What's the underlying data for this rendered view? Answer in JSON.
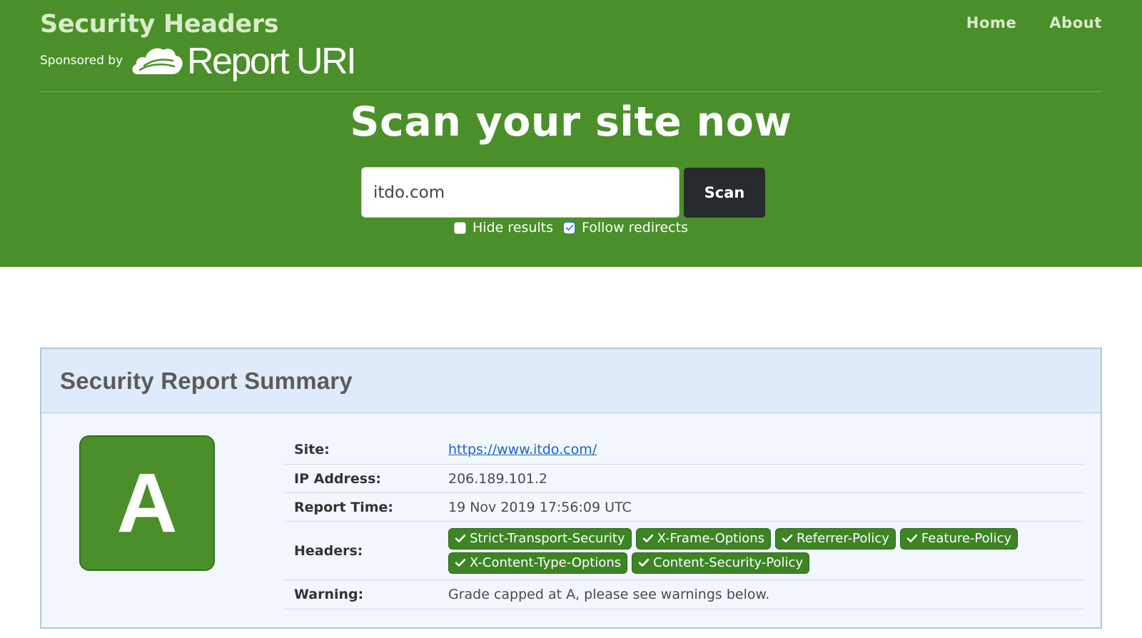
{
  "header": {
    "brand_title": "Security Headers",
    "sponsor_label": "Sponsored by",
    "sponsor_logo_text": "Report URI",
    "nav": [
      {
        "label": "Home"
      },
      {
        "label": "About"
      }
    ],
    "hero_title": "Scan your site now"
  },
  "scan": {
    "input_value": "itdo.com",
    "button_label": "Scan",
    "options": [
      {
        "label": "Hide results",
        "checked": false
      },
      {
        "label": "Follow redirects",
        "checked": true
      }
    ]
  },
  "report": {
    "title": "Security Report Summary",
    "grade": "A",
    "rows": {
      "site": {
        "label": "Site:",
        "value": "https://www.itdo.com/"
      },
      "ip": {
        "label": "IP Address:",
        "value": "206.189.101.2"
      },
      "time": {
        "label": "Report Time:",
        "value": "19 Nov 2019 17:56:09 UTC"
      },
      "headers": {
        "label": "Headers:"
      },
      "warning": {
        "label": "Warning:",
        "value": "Grade capped at A, please see warnings below."
      }
    },
    "headers": [
      "Strict-Transport-Security",
      "X-Frame-Options",
      "Referrer-Policy",
      "Feature-Policy",
      "X-Content-Type-Options",
      "Content-Security-Policy"
    ]
  },
  "colors": {
    "brand_green": "#4a8f2a",
    "pill_green": "#3d8424",
    "panel_bg": "#f1f7fd",
    "panel_header_bg": "#dfebfa",
    "button_dark": "#272a2e",
    "link_blue": "#1f63c6"
  },
  "icons": {
    "logo": "cloud-icon",
    "header_pill": "check-icon",
    "checkbox_checked": "check-icon"
  }
}
